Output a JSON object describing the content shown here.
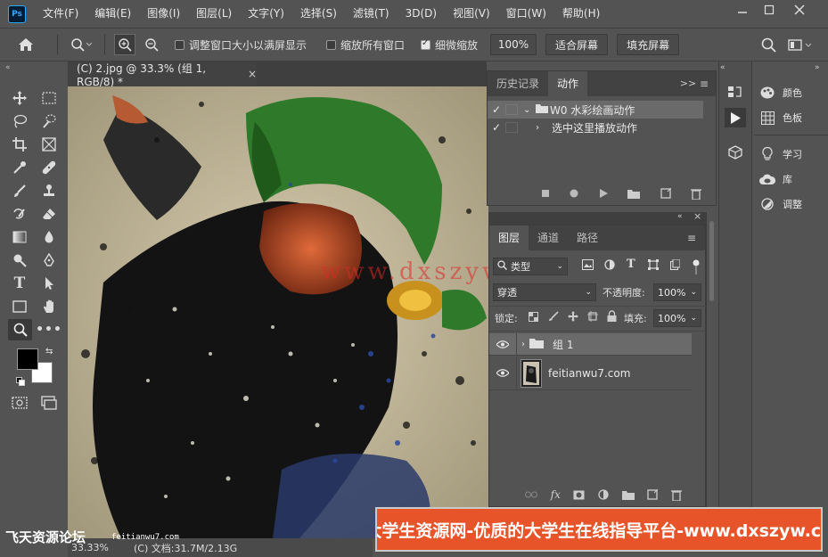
{
  "menubar": {
    "logo": "Ps",
    "items": [
      "文件(F)",
      "编辑(E)",
      "图像(I)",
      "图层(L)",
      "文字(Y)",
      "选择(S)",
      "滤镜(T)",
      "3D(D)",
      "视图(V)",
      "窗口(W)",
      "帮助(H)"
    ]
  },
  "options": {
    "resize_windows": "调整窗口大小以满屏显示",
    "zoom_all": "缩放所有窗口",
    "scrubby_zoom": "细微缩放",
    "zoom_value": "100%",
    "fit_screen": "适合屏幕",
    "fill_screen": "填充屏幕"
  },
  "document": {
    "tab_title": "(C) 2.jpg @ 33.3% (组 1, RGB/8) *",
    "zoom_status": "33.33%",
    "doc_status": "(C) 文档:31.7M/2.13G",
    "watermark": "www.dxszyw.cn"
  },
  "history_panel": {
    "tabs": [
      "历史记录",
      "动作"
    ],
    "actions": [
      {
        "label": "W0 水彩绘画动作",
        "expanded": true
      },
      {
        "label": "选中这里播放动作",
        "expanded": false
      }
    ]
  },
  "layers_panel": {
    "tabs": [
      "图层",
      "通道",
      "路径"
    ],
    "filter_kind": "类型",
    "blend_mode": "穿透",
    "opacity_label": "不透明度:",
    "opacity": "100%",
    "lock_label": "锁定:",
    "fill_label": "填充:",
    "fill": "100%",
    "layers": [
      {
        "name": "组 1",
        "type": "group",
        "selected": true
      },
      {
        "name": "feitianwu7.com",
        "type": "pixel",
        "selected": false
      }
    ]
  },
  "right_dock": {
    "items": [
      "颜色",
      "色板",
      "学习",
      "库",
      "调整"
    ]
  },
  "overlay": {
    "banner": "大学生资源网-优质的大学生在线指导平台-www.dxszyw.cn",
    "left_watermark": "飞天资源论坛",
    "left_url": "feitianwu7.com"
  }
}
